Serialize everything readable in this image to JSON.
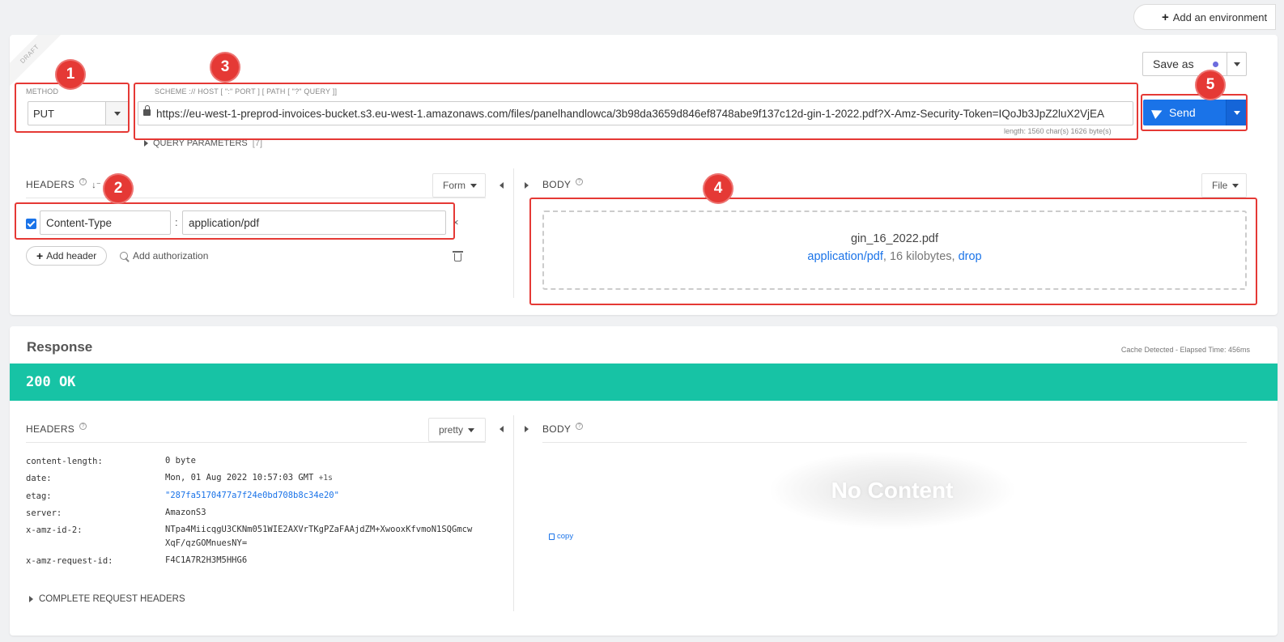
{
  "environment": {
    "add_label": "Add an environment"
  },
  "request": {
    "draft_label": "DRAFT",
    "method_label": "METHOD",
    "method_value": "PUT",
    "url_label": "SCHEME :// HOST [ \":\" PORT ] [ PATH [ \"?\" QUERY ]]",
    "url_value": "https://eu-west-1-preprod-invoices-bucket.s3.eu-west-1.amazonaws.com/files/panelhandlowca/3b98da3659d846ef8748abe9f137c12d-gin-1-2022.pdf?X-Amz-Security-Token=IQoJb3JpZ2luX2VjEA",
    "url_length": "length: 1560 char(s) 1626 byte(s)",
    "query_params_label": "QUERY PARAMETERS",
    "query_params_count": "[7]",
    "save_as_label": "Save as",
    "send_label": "Send",
    "headers_title": "HEADERS",
    "headers_mode": "Form",
    "header_rows": [
      {
        "enabled": true,
        "name": "Content-Type",
        "value": "application/pdf"
      }
    ],
    "add_header_label": "Add header",
    "add_auth_label": "Add authorization",
    "body_title": "BODY",
    "body_mode": "File",
    "body_file": {
      "name": "gin_16_2022.pdf",
      "type": "application/pdf",
      "size": "16 kilobytes",
      "drop": "drop"
    }
  },
  "annotations": [
    "1",
    "2",
    "3",
    "4",
    "5"
  ],
  "response": {
    "title": "Response",
    "cache_info": "Cache Detected - Elapsed Time: 456ms",
    "status": "200 OK",
    "headers_title": "HEADERS",
    "headers_mode": "pretty",
    "headers": [
      {
        "key": "content-length:",
        "value": "0 byte",
        "extra": ""
      },
      {
        "key": "date:",
        "value": "Mon, 01 Aug 2022 10:57:03 GMT",
        "extra": "+1s"
      },
      {
        "key": "etag:",
        "value": "\"287fa5170477a7f24e0bd708b8c34e20\"",
        "extra": ""
      },
      {
        "key": "server:",
        "value": "AmazonS3",
        "extra": ""
      },
      {
        "key": "x-amz-id-2:",
        "value": "NTpa4MiicqgU3CKNm051WIE2AXVrTKgPZaFAAjdZM+XwooxKfvmoN1SQGmcw",
        "value2": "XqF/qzGOMnuesNY=",
        "extra": ""
      },
      {
        "key": "x-amz-request-id:",
        "value": "F4C1A7R2H3M5HHG6",
        "extra": ""
      }
    ],
    "complete_headers_label": "COMPLETE REQUEST HEADERS",
    "body_title": "BODY",
    "no_content": "No Content",
    "copy_label": "copy"
  },
  "colors": {
    "accent": "#1a73e8",
    "status_ok": "#17c3a5",
    "annotation": "#e53935"
  }
}
